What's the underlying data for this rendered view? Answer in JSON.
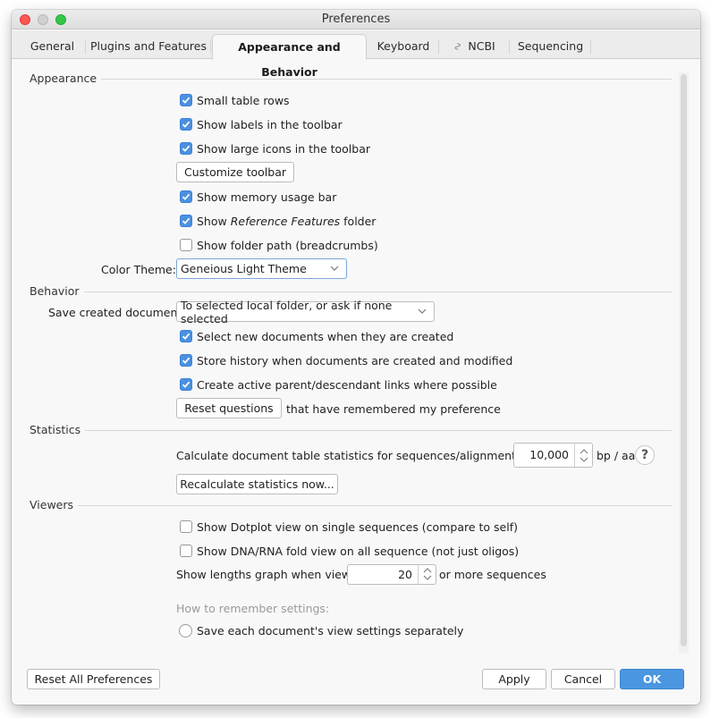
{
  "window": {
    "title": "Preferences"
  },
  "tabs": [
    {
      "label": "General",
      "active": false
    },
    {
      "label": "Plugins and Features",
      "active": false
    },
    {
      "label": "Appearance and Behavior",
      "active": true
    },
    {
      "label": "Keyboard",
      "active": false
    },
    {
      "label": "NCBI",
      "active": false,
      "icon": "ncbi-helix-icon"
    },
    {
      "label": "Sequencing",
      "active": false
    }
  ],
  "appearance": {
    "title": "Appearance",
    "small_table_rows": {
      "label": "Small table rows",
      "checked": true
    },
    "show_labels_toolbar": {
      "label": "Show labels in the toolbar",
      "checked": true
    },
    "show_large_icons": {
      "label": "Show large icons in the toolbar",
      "checked": true
    },
    "customize_toolbar_label": "Customize toolbar",
    "show_memory_bar": {
      "label": "Show memory usage bar",
      "checked": true
    },
    "show_reference_features": {
      "label_prefix": "Show ",
      "label_italic": "Reference Features",
      "label_suffix": " folder",
      "checked": true
    },
    "show_folder_path": {
      "label": "Show folder path (breadcrumbs)",
      "checked": false
    },
    "color_theme_label": "Color Theme:",
    "color_theme_value": "Geneious Light Theme"
  },
  "behavior": {
    "title": "Behavior",
    "save_created_label": "Save created documents",
    "save_created_value": "To selected local folder, or ask if none selected",
    "select_new_docs": {
      "label": "Select new documents when they are created",
      "checked": true
    },
    "store_history": {
      "label": "Store history when documents are created and modified",
      "checked": true
    },
    "create_links": {
      "label": "Create active parent/descendant links where possible",
      "checked": true
    },
    "reset_questions_label": "Reset questions",
    "reset_questions_suffix": "that have remembered my preference"
  },
  "statistics": {
    "title": "Statistics",
    "calc_label": "Calculate document table statistics for sequences/alignments up to",
    "calc_value": "10,000",
    "calc_unit": "bp / aa",
    "help_label": "?",
    "recalc_label": "Recalculate statistics now..."
  },
  "viewers": {
    "title": "Viewers",
    "dotplot": {
      "label": "Show Dotplot view on single sequences (compare to self)",
      "checked": false
    },
    "fold_view": {
      "label": "Show DNA/RNA fold view on all sequence (not just oligos)",
      "checked": false
    },
    "lengths_prefix": "Show lengths graph when viewing",
    "lengths_value": "20",
    "lengths_suffix": "or more sequences",
    "remember_label": "How to remember settings:",
    "save_separately": {
      "label": "Save each document's view settings separately",
      "selected": false
    }
  },
  "footer": {
    "reset_all_label": "Reset All Preferences",
    "apply_label": "Apply",
    "cancel_label": "Cancel",
    "ok_label": "OK"
  },
  "colors": {
    "accent": "#4a90e2",
    "primary_button": "#4a96e0"
  }
}
